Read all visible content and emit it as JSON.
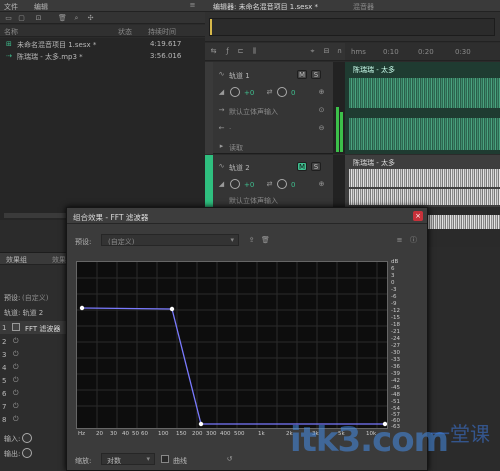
{
  "menu": {
    "file": "文件",
    "edit": "编辑"
  },
  "files_panel": {
    "columns": {
      "name": "名称",
      "status": "状态",
      "duration": "持续时间"
    },
    "items": [
      {
        "name": "未命名混音项目 1.sesx *",
        "duration": "4:19.617"
      },
      {
        "name": "陈瑞瑞 - 太多.mp3 *",
        "duration": "3:56.016"
      }
    ]
  },
  "editor": {
    "tab_active": "编辑器: 未命名混音项目 1.sesx *",
    "tab_inactive": "混音器",
    "timecodes": [
      "hms",
      "0:10",
      "0:20",
      "0:30"
    ],
    "track1": {
      "name": "轨道 1",
      "volume": "+0",
      "pan": "0",
      "input": "默认立体声输入",
      "clip_label": "陈瑞瑞 - 太多",
      "read": "读取"
    },
    "track2": {
      "name": "轨道 2",
      "volume": "+0",
      "pan": "0",
      "input": "默认立体声输入",
      "clip_label": "陈瑞瑞 - 太多"
    }
  },
  "effects_rack": {
    "tab1": "效果组",
    "tab2": "效果",
    "preset_label": "预设:",
    "preset_value": "(自定义)",
    "track_label": "轨道: 轨道 2",
    "slots": [
      {
        "num": "1",
        "label": "FFT 滤波器"
      },
      {
        "num": "2",
        "label": ""
      },
      {
        "num": "3",
        "label": ""
      },
      {
        "num": "4",
        "label": ""
      },
      {
        "num": "5",
        "label": ""
      },
      {
        "num": "6",
        "label": ""
      },
      {
        "num": "7",
        "label": ""
      },
      {
        "num": "8",
        "label": ""
      }
    ],
    "input_label": "输入:",
    "output_label": "输出:"
  },
  "dialog": {
    "title": "组合效果 - FFT 滤波器",
    "preset_label": "预设:",
    "preset_value": "(自定义)",
    "db_ticks": [
      "dB",
      "6",
      "3",
      "0",
      "-3",
      "-6",
      "-9",
      "-12",
      "-15",
      "-18",
      "-21",
      "-24",
      "-27",
      "-30",
      "-33",
      "-36",
      "-39",
      "-42",
      "-45",
      "-48",
      "-51",
      "-54",
      "-57",
      "-60",
      "-63",
      "-66"
    ],
    "hz_ticks": [
      "Hz",
      "20",
      "30",
      "40",
      "50",
      "60",
      "100",
      "150",
      "200",
      "300",
      "400",
      "500",
      "1k",
      "2k",
      "3k",
      "5k",
      "10k"
    ],
    "scale_label": "缩放:",
    "scale_value": "对数",
    "spline_label": "曲线"
  },
  "watermark": {
    "text": "itk3.com",
    "cn": "一堂课"
  },
  "colors": {
    "accent_green": "#2fbf7f",
    "filter_line": "#7a7aff",
    "dialog_title": "#3d3d3d",
    "close_red": "#c8313a"
  }
}
